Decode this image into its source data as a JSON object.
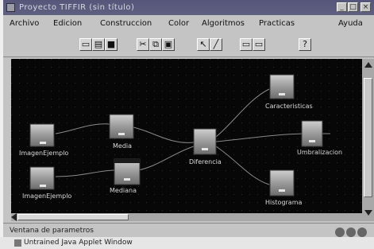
{
  "window": {
    "title": "Proyecto TIFFIR (sin título)",
    "buttons": [
      "_",
      "□",
      "×"
    ]
  },
  "menu": {
    "items": [
      "Archivo",
      "Edicion",
      "Construccion",
      "Color",
      "Algoritmos",
      "Practicas",
      "Ayuda"
    ]
  },
  "toolbar": {
    "buttons": [
      {
        "name": "new",
        "glyph": "▭"
      },
      {
        "name": "open",
        "glyph": "▤"
      },
      {
        "name": "save",
        "glyph": "■"
      },
      {
        "name": "cut",
        "glyph": "✂"
      },
      {
        "name": "copy",
        "glyph": "⧉"
      },
      {
        "name": "paste",
        "glyph": "▣"
      },
      {
        "name": "select",
        "glyph": "↖"
      },
      {
        "name": "connect",
        "glyph": "╱"
      },
      {
        "name": "window1",
        "glyph": "▭"
      },
      {
        "name": "window2",
        "glyph": "▭"
      },
      {
        "name": "help",
        "glyph": "?"
      }
    ]
  },
  "graph": {
    "nodes": [
      {
        "id": "imagen1",
        "label": "ImagenEjemplo"
      },
      {
        "id": "imagen2",
        "label": "ImagenEjemplo"
      },
      {
        "id": "media",
        "label": "Media"
      },
      {
        "id": "mediana",
        "label": "Mediana"
      },
      {
        "id": "diferencia",
        "label": "Diferencia"
      },
      {
        "id": "caracteristicas",
        "label": "Caracteristicas"
      },
      {
        "id": "umbralizacion",
        "label": "Umbralizacion"
      },
      {
        "id": "histograma",
        "label": "Histograma"
      }
    ]
  },
  "status": {
    "text": "Ventana de parametros"
  },
  "taskbar": {
    "text": "Untrained Java Applet Window"
  }
}
